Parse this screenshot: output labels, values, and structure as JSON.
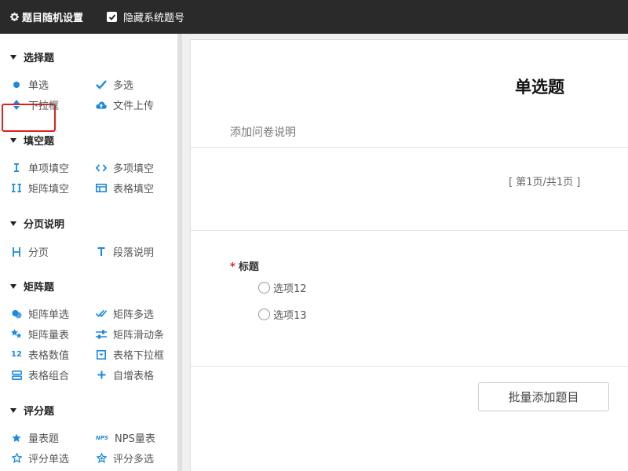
{
  "topbar": {
    "title": "题目随机设置",
    "hide_label": "隐藏系统题号",
    "hide_checked": true
  },
  "sidebar": {
    "sections": [
      {
        "title": "选择题",
        "items": [
          {
            "label": "单选",
            "icon": "dot-icon",
            "selected": true
          },
          {
            "label": "多选",
            "icon": "check-icon"
          },
          {
            "label": "下拉框",
            "icon": "sort-arrows-icon"
          },
          {
            "label": "文件上传",
            "icon": "cloud-upload-icon"
          }
        ]
      },
      {
        "title": "填空题",
        "items": [
          {
            "label": "单项填空",
            "icon": "text-cursor-icon"
          },
          {
            "label": "多项填空",
            "icon": "code-brackets-icon"
          },
          {
            "label": "矩阵填空",
            "icon": "double-cursor-icon"
          },
          {
            "label": "表格填空",
            "icon": "table-icon"
          }
        ]
      },
      {
        "title": "分页说明",
        "items": [
          {
            "label": "分页",
            "icon": "page-break-icon"
          },
          {
            "label": "段落说明",
            "icon": "text-t-icon"
          }
        ]
      },
      {
        "title": "矩阵题",
        "items": [
          {
            "label": "矩阵单选",
            "icon": "circles-icon"
          },
          {
            "label": "矩阵多选",
            "icon": "double-check-icon"
          },
          {
            "label": "矩阵量表",
            "icon": "stars-icon"
          },
          {
            "label": "矩阵滑动条",
            "icon": "sliders-icon"
          },
          {
            "label": "表格数值",
            "icon": "number-12-icon"
          },
          {
            "label": "表格下拉框",
            "icon": "dropdown-box-icon"
          },
          {
            "label": "表格组合",
            "icon": "combo-icon"
          },
          {
            "label": "自增表格",
            "icon": "plus-icon"
          }
        ]
      },
      {
        "title": "评分题",
        "items": [
          {
            "label": "量表题",
            "icon": "star-icon"
          },
          {
            "label": "NPS量表",
            "icon": "nps-icon"
          },
          {
            "label": "评分单选",
            "icon": "star-outline-icon"
          },
          {
            "label": "评分多选",
            "icon": "star-outline-icon"
          }
        ]
      }
    ]
  },
  "main": {
    "title": "单选题",
    "description": "添加问卷说明",
    "page_info": "[ 第1页/共1页 ]",
    "question": {
      "required_mark": "*",
      "label": "标题",
      "options": [
        "选项12",
        "选项13"
      ]
    },
    "batch_add_button": "批量添加题目"
  },
  "colors": {
    "topbar_bg": "#2a2a2a",
    "icon_blue": "#1a8ae0",
    "required_red": "#e02020",
    "selection_border": "#e02020"
  }
}
